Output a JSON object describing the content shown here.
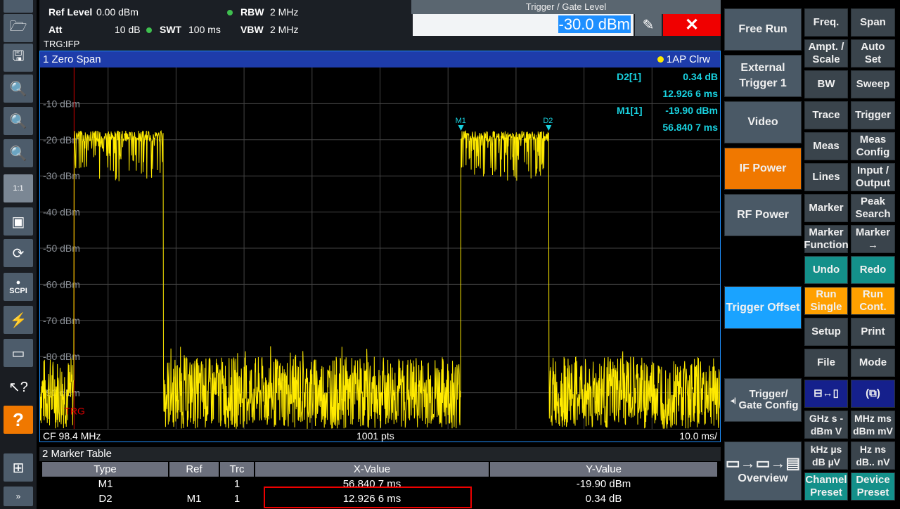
{
  "toolbar": {
    "items": [
      "folder-icon",
      "save-icon",
      "zoom-mode-icon",
      "zoom-plus-icon",
      "multi-zoom-icon",
      "zoom-off-icon",
      "full-screen-icon",
      "display-update-icon",
      "scpi-icon",
      "sequencer-icon",
      "remote-display-icon",
      "help-pointer-icon",
      "help-icon",
      "windows-icon",
      "more-icon"
    ],
    "scpi_label": "SCPI",
    "zoom_off_label": "1:1"
  },
  "header": {
    "ref_level_label": "Ref Level",
    "ref_level": "0.00 dBm",
    "att_label": "Att",
    "att": "10 dB",
    "swt_label": "SWT",
    "swt": "100 ms",
    "rbw_label": "RBW",
    "rbw": "2 MHz",
    "vbw_label": "VBW",
    "vbw": "2 MHz",
    "trg": "TRG:IFP"
  },
  "trigger_dialog": {
    "title": "Trigger / Gate Level",
    "value": "-30.0 dBm",
    "close": "✕",
    "edit_icon": "✎"
  },
  "window": {
    "title": "1 Zero Span",
    "trace_badge": "1AP Clrw",
    "trace_color": "#ffea00",
    "cf": "CF 98.4 MHz",
    "points": "1001 pts",
    "scale": "10.0 ms/",
    "trg_label": "TRG"
  },
  "markers_info": [
    {
      "name": "D2[1]",
      "value": "0.34 dB",
      "x": "12.926 6 ms"
    },
    {
      "name": "M1[1]",
      "value": "-19.90 dBm",
      "x": "56.840 7 ms"
    }
  ],
  "chart_data": {
    "type": "line",
    "xlim": [
      0,
      100
    ],
    "ylim": [
      -100,
      0
    ],
    "ylabel_ticks": [
      "-10 dBm",
      "-20 dBm",
      "-30 dBm",
      "-40 dBm",
      "-50 dBm",
      "-60 dBm",
      "-70 dBm",
      "-80 dBm",
      "-90 dBm"
    ],
    "grid": true,
    "bursts_ms": [
      [
        5,
        18.1
      ],
      [
        61.9,
        74.8
      ]
    ],
    "burst_level_dBm": -20,
    "noise_level_dBm": [
      -100,
      -80
    ],
    "trigger_level_dBm": -30,
    "marker_labels": [
      "M1",
      "D2"
    ]
  },
  "marker_table": {
    "title": "2 Marker Table",
    "columns": [
      "Type",
      "Ref",
      "Trc",
      "X-Value",
      "Y-Value"
    ],
    "rows": [
      [
        "M1",
        "",
        "1",
        "56.840 7 ms",
        "-19.90 dBm"
      ],
      [
        "D2",
        "M1",
        "1",
        "12.926 6 ms",
        "0.34 dB"
      ]
    ]
  },
  "softkeys": [
    "Free Run",
    "External Trigger 1",
    "Video",
    "IF Power",
    "RF Power",
    "Trigger Offset",
    "Trigger/ Gate Config",
    "Overview"
  ],
  "hardkeys": [
    [
      "Freq.",
      "Span"
    ],
    [
      "Ampt. / Scale",
      "Auto Set"
    ],
    [
      "BW",
      "Sweep"
    ],
    [
      "Trace",
      "Trigger"
    ],
    [
      "Meas",
      "Meas Config"
    ],
    [
      "Lines",
      "Input / Output"
    ],
    [
      "Marker",
      "Peak Search"
    ],
    [
      "Marker Function",
      "Marker →"
    ],
    [
      "Undo",
      "Redo"
    ],
    [
      "Run Single",
      "Run Cont."
    ],
    [
      "Setup",
      "Print"
    ],
    [
      "File",
      "Mode"
    ],
    [
      "",
      ""
    ],
    [
      "GHz s -dBm V",
      "MHz ms dBm mV"
    ],
    [
      "kHz µs dB µV",
      "Hz ns dB.. nV"
    ],
    [
      "Channel Preset",
      "Device Preset"
    ]
  ]
}
